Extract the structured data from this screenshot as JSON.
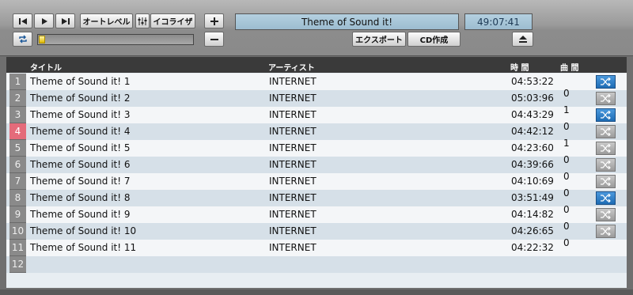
{
  "player": {
    "now_playing": "Theme of Sound it!",
    "elapsed": "49:07:41",
    "auto_level_label": "オートレベル",
    "equalizer_label": "イコライザ",
    "export_label": "エクスポート",
    "cd_label": "CD作成",
    "progress": 0.04
  },
  "columns": {
    "title": "タイトル",
    "artist": "アーティスト",
    "time": "時 間",
    "plays": "曲 間"
  },
  "tracks": [
    {
      "n": "1",
      "title": "Theme of Sound it! 1",
      "artist": "INTERNET",
      "time": "04:53:22",
      "shuffle": true
    },
    {
      "n": "2",
      "title": "Theme of Sound it! 2",
      "artist": "INTERNET",
      "time": "05:03:96",
      "shuffle": false
    },
    {
      "n": "3",
      "title": "Theme of Sound it! 3",
      "artist": "INTERNET",
      "time": "04:43:29",
      "shuffle": true
    },
    {
      "n": "4",
      "title": "Theme of Sound it! 4",
      "artist": "INTERNET",
      "time": "04:42:12",
      "shuffle": false
    },
    {
      "n": "5",
      "title": "Theme of Sound it! 5",
      "artist": "INTERNET",
      "time": "04:23:60",
      "shuffle": false
    },
    {
      "n": "6",
      "title": "Theme of Sound it! 6",
      "artist": "INTERNET",
      "time": "04:39:66",
      "shuffle": false
    },
    {
      "n": "7",
      "title": "Theme of Sound it! 7",
      "artist": "INTERNET",
      "time": "04:10:69",
      "shuffle": false
    },
    {
      "n": "8",
      "title": "Theme of Sound it! 8",
      "artist": "INTERNET",
      "time": "03:51:49",
      "shuffle": true
    },
    {
      "n": "9",
      "title": "Theme of Sound it! 9",
      "artist": "INTERNET",
      "time": "04:14:82",
      "shuffle": false
    },
    {
      "n": "10",
      "title": "Theme of Sound it! 10",
      "artist": "INTERNET",
      "time": "04:26:65",
      "shuffle": false
    },
    {
      "n": "11",
      "title": "Theme of Sound it! 11",
      "artist": "INTERNET",
      "time": "04:22:32",
      "shuffle": null
    },
    {
      "n": "12",
      "title": "",
      "artist": "",
      "time": "",
      "shuffle": null
    }
  ],
  "gaps": [
    "0",
    "1",
    "0",
    "1",
    "0",
    "0",
    "0",
    "0",
    "0",
    "0"
  ],
  "colors": {
    "highlight_row_number": "#e46b7a",
    "shuffle_on": "#2a7bc6",
    "display_bg": "#a8c6d8"
  }
}
